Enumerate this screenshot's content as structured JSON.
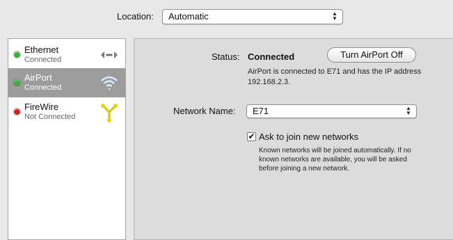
{
  "location": {
    "label": "Location:",
    "value": "Automatic"
  },
  "services": [
    {
      "name": "Ethernet",
      "status": "Connected",
      "dot": "#3ab03a",
      "icon": "ethernet-icon"
    },
    {
      "name": "AirPort",
      "status": "Connected",
      "dot": "#3ab03a",
      "icon": "wifi-icon",
      "selected": true
    },
    {
      "name": "FireWire",
      "status": "Not Connected",
      "dot": "#d82020",
      "icon": "firewire-icon"
    }
  ],
  "status": {
    "label": "Status:",
    "value": "Connected",
    "button": "Turn AirPort Off",
    "description": "AirPort is connected to E71 and has the IP address 192.168.2.3."
  },
  "network": {
    "label": "Network Name:",
    "value": "E71",
    "ask_label": "Ask to join new networks",
    "ask_checked": true,
    "ask_description": "Known networks will be joined automatically. If no known networks are available, you will be asked before joining a new network."
  }
}
